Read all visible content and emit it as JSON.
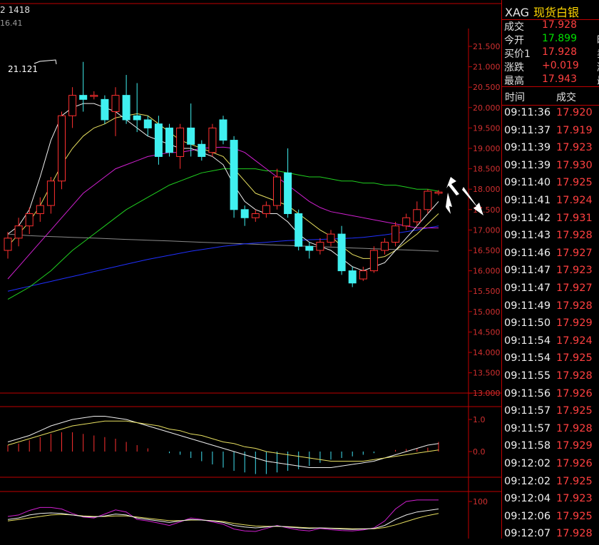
{
  "header": {
    "top_left": "2 1418",
    "sub_left": "16.41"
  },
  "main_chart": {
    "high_label": "21.121",
    "y_ticks": [
      "21.500",
      "21.000",
      "20.500",
      "20.000",
      "19.500",
      "19.000",
      "18.500",
      "18.000",
      "17.500",
      "17.000",
      "16.500",
      "16.000",
      "15.500",
      "15.000",
      "14.500",
      "14.000",
      "13.500",
      "13.000"
    ],
    "candles": [
      [
        16.5,
        16.8,
        16.3,
        16.95
      ],
      [
        16.8,
        17.1,
        16.6,
        17.3
      ],
      [
        17.1,
        17.4,
        16.9,
        17.55
      ],
      [
        17.4,
        17.6,
        17.2,
        17.8
      ],
      [
        17.6,
        18.2,
        17.4,
        18.3
      ],
      [
        18.2,
        19.8,
        18.0,
        19.9
      ],
      [
        19.8,
        20.3,
        19.5,
        20.5
      ],
      [
        20.3,
        20.2,
        19.9,
        21.12
      ],
      [
        20.3,
        20.3,
        20.2,
        20.4
      ],
      [
        20.2,
        19.7,
        19.6,
        20.3
      ],
      [
        19.9,
        20.3,
        19.3,
        20.5
      ],
      [
        20.3,
        19.7,
        19.6,
        20.8
      ],
      [
        19.8,
        19.7,
        19.4,
        20.6
      ],
      [
        19.7,
        19.5,
        19.3,
        19.8
      ],
      [
        19.6,
        18.8,
        18.6,
        19.8
      ],
      [
        19.5,
        18.9,
        18.8,
        19.6
      ],
      [
        18.8,
        19.5,
        18.5,
        19.6
      ],
      [
        19.5,
        19.1,
        18.8,
        20.1
      ],
      [
        19.1,
        18.8,
        18.7,
        19.2
      ],
      [
        18.9,
        19.5,
        18.8,
        19.6
      ],
      [
        19.7,
        19.2,
        19.1,
        19.8
      ],
      [
        19.2,
        17.5,
        17.3,
        19.3
      ],
      [
        17.5,
        17.3,
        17.1,
        17.6
      ],
      [
        17.3,
        17.4,
        17.2,
        17.5
      ],
      [
        17.4,
        17.6,
        17.3,
        17.7
      ],
      [
        17.6,
        18.3,
        17.5,
        18.5
      ],
      [
        18.4,
        17.4,
        17.3,
        19.0
      ],
      [
        17.4,
        16.6,
        16.5,
        17.5
      ],
      [
        16.6,
        16.5,
        16.3,
        16.7
      ],
      [
        16.5,
        16.7,
        16.4,
        16.8
      ],
      [
        16.7,
        16.9,
        16.6,
        17.0
      ],
      [
        16.9,
        16.0,
        15.9,
        17.1
      ],
      [
        16.0,
        15.7,
        15.6,
        16.1
      ],
      [
        15.8,
        16.0,
        15.75,
        16.1
      ],
      [
        16.0,
        16.5,
        15.95,
        16.6
      ],
      [
        16.5,
        16.7,
        16.4,
        16.8
      ],
      [
        16.7,
        17.1,
        16.6,
        17.2
      ],
      [
        17.1,
        17.3,
        17.0,
        17.4
      ],
      [
        17.2,
        17.5,
        17.1,
        17.7
      ],
      [
        17.5,
        17.95,
        17.4,
        18.0
      ],
      [
        17.9,
        17.93,
        17.85,
        17.98
      ]
    ],
    "ma_yellow": [
      16.6,
      16.9,
      17.2,
      17.6,
      18.1,
      18.6,
      19.0,
      19.3,
      19.5,
      19.6,
      19.75,
      19.8,
      19.85,
      19.8,
      19.6,
      19.4,
      19.2,
      19.1,
      19.0,
      18.9,
      18.8,
      18.5,
      18.2,
      17.9,
      17.8,
      17.7,
      17.6,
      17.4,
      17.2,
      17.0,
      16.85,
      16.6,
      16.4,
      16.3,
      16.3,
      16.35,
      16.5,
      16.7,
      16.9,
      17.15,
      17.4
    ],
    "ma_white": [
      16.9,
      17.1,
      17.5,
      18.3,
      19.2,
      19.8,
      20.0,
      20.1,
      20.1,
      20.0,
      19.9,
      19.7,
      19.5,
      19.3,
      19.2,
      19.1,
      19.0,
      19.0,
      18.9,
      18.8,
      18.6,
      18.1,
      17.7,
      17.5,
      17.4,
      17.4,
      17.2,
      16.9,
      16.7,
      16.6,
      16.5,
      16.3,
      16.1,
      16.0,
      16.1,
      16.2,
      16.5,
      16.8,
      17.1,
      17.4,
      17.7
    ],
    "ma_magenta": [
      15.8,
      16.1,
      16.4,
      16.7,
      17.0,
      17.3,
      17.6,
      17.9,
      18.1,
      18.3,
      18.5,
      18.6,
      18.7,
      18.8,
      18.85,
      18.9,
      18.9,
      18.95,
      19.0,
      19.02,
      19.03,
      19.0,
      18.9,
      18.7,
      18.5,
      18.3,
      18.1,
      17.9,
      17.7,
      17.55,
      17.45,
      17.4,
      17.35,
      17.3,
      17.25,
      17.2,
      17.15,
      17.1,
      17.05,
      17.05,
      17.05
    ],
    "ma_green": [
      15.3,
      15.45,
      15.6,
      15.8,
      16.0,
      16.25,
      16.5,
      16.7,
      16.9,
      17.1,
      17.3,
      17.5,
      17.65,
      17.8,
      17.95,
      18.1,
      18.2,
      18.3,
      18.4,
      18.45,
      18.5,
      18.5,
      18.5,
      18.5,
      18.45,
      18.45,
      18.4,
      18.35,
      18.3,
      18.3,
      18.25,
      18.2,
      18.2,
      18.15,
      18.15,
      18.1,
      18.1,
      18.05,
      18.0,
      18.0,
      17.95
    ],
    "ma_blue": [
      15.5,
      15.56,
      15.62,
      15.68,
      15.74,
      15.8,
      15.86,
      15.92,
      15.98,
      16.04,
      16.1,
      16.16,
      16.22,
      16.28,
      16.33,
      16.38,
      16.43,
      16.48,
      16.52,
      16.56,
      16.6,
      16.63,
      16.66,
      16.68,
      16.7,
      16.72,
      16.74,
      16.75,
      16.76,
      16.77,
      16.78,
      16.79,
      16.8,
      16.82,
      16.85,
      16.88,
      16.92,
      16.96,
      17.0,
      17.05,
      17.1
    ],
    "ma_gray": [
      16.9,
      16.88,
      16.86,
      16.85,
      16.84,
      16.83,
      16.82,
      16.81,
      16.8,
      16.79,
      16.78,
      16.77,
      16.76,
      16.75,
      16.74,
      16.73,
      16.72,
      16.71,
      16.7,
      16.69,
      16.68,
      16.67,
      16.66,
      16.65,
      16.64,
      16.63,
      16.62,
      16.61,
      16.6,
      16.59,
      16.58,
      16.57,
      16.56,
      16.55,
      16.54,
      16.53,
      16.52,
      16.51,
      16.5,
      16.49,
      16.48
    ]
  },
  "macd_panel": {
    "y_ticks": [
      "1.0",
      "0.0"
    ],
    "bars": [
      0.2,
      0.25,
      0.35,
      0.45,
      0.55,
      0.6,
      0.6,
      0.55,
      0.5,
      0.45,
      0.4,
      0.3,
      0.2,
      0.1,
      0.0,
      -0.05,
      -0.1,
      -0.2,
      -0.3,
      -0.4,
      -0.5,
      -0.6,
      -0.65,
      -0.7,
      -0.7,
      -0.65,
      -0.6,
      -0.55,
      -0.45,
      -0.35,
      -0.25,
      -0.2,
      -0.15,
      -0.1,
      -0.05,
      0.0,
      0.05,
      0.08,
      0.1,
      0.12,
      0.3
    ],
    "dif": [
      0.3,
      0.4,
      0.5,
      0.65,
      0.8,
      0.9,
      1.0,
      1.05,
      1.1,
      1.1,
      1.05,
      1.0,
      0.9,
      0.8,
      0.7,
      0.6,
      0.5,
      0.4,
      0.3,
      0.2,
      0.1,
      0.0,
      -0.1,
      -0.2,
      -0.3,
      -0.35,
      -0.4,
      -0.45,
      -0.5,
      -0.5,
      -0.5,
      -0.45,
      -0.4,
      -0.35,
      -0.3,
      -0.2,
      -0.1,
      0.0,
      0.1,
      0.2,
      0.25
    ],
    "dea": [
      0.2,
      0.3,
      0.4,
      0.5,
      0.6,
      0.7,
      0.8,
      0.85,
      0.9,
      0.95,
      0.95,
      0.95,
      0.9,
      0.85,
      0.8,
      0.7,
      0.65,
      0.55,
      0.5,
      0.4,
      0.3,
      0.25,
      0.15,
      0.1,
      0.0,
      -0.05,
      -0.1,
      -0.15,
      -0.2,
      -0.25,
      -0.3,
      -0.3,
      -0.3,
      -0.3,
      -0.25,
      -0.2,
      -0.15,
      -0.1,
      -0.05,
      0.0,
      0.05
    ]
  },
  "kdj_panel": {
    "y_ticks": [
      "100"
    ],
    "k": [
      40,
      45,
      55,
      60,
      62,
      60,
      55,
      50,
      48,
      52,
      58,
      55,
      45,
      40,
      35,
      30,
      35,
      40,
      38,
      35,
      30,
      20,
      15,
      12,
      15,
      18,
      15,
      12,
      10,
      12,
      10,
      8,
      7,
      8,
      10,
      20,
      40,
      55,
      65,
      70,
      75
    ],
    "d": [
      35,
      40,
      45,
      50,
      55,
      57,
      55,
      52,
      50,
      50,
      52,
      52,
      48,
      44,
      40,
      36,
      36,
      38,
      38,
      36,
      33,
      27,
      22,
      18,
      17,
      17,
      16,
      14,
      12,
      12,
      11,
      10,
      9,
      9,
      9,
      13,
      22,
      33,
      44,
      53,
      60
    ],
    "j": [
      50,
      55,
      70,
      80,
      80,
      75,
      60,
      48,
      45,
      58,
      72,
      65,
      40,
      35,
      28,
      20,
      32,
      45,
      40,
      32,
      24,
      8,
      2,
      0,
      10,
      20,
      12,
      5,
      2,
      10,
      6,
      3,
      2,
      5,
      12,
      35,
      75,
      100,
      105,
      105,
      105
    ]
  },
  "quote": {
    "code": "XAG",
    "name": "现货白银",
    "rows": [
      {
        "label": "成交",
        "value": "17.928",
        "color": "#ff4040",
        "cut": ""
      },
      {
        "label": "今开",
        "value": "17.899",
        "color": "#00e000",
        "cut": "昨"
      },
      {
        "label": "买价1",
        "value": "17.928",
        "color": "#ff4040",
        "cut": "卖"
      },
      {
        "label": "涨跌",
        "value": "+0.019",
        "color": "#ff4040",
        "cut": "涨"
      },
      {
        "label": "最高",
        "value": "17.943",
        "color": "#ff4040",
        "cut": "最"
      }
    ]
  },
  "trades": {
    "header_time": "时间",
    "header_price": "成交",
    "rows": [
      [
        "09:11:36",
        "17.920"
      ],
      [
        "09:11:37",
        "17.919"
      ],
      [
        "09:11:39",
        "17.923"
      ],
      [
        "09:11:39",
        "17.930"
      ],
      [
        "09:11:40",
        "17.925"
      ],
      [
        "09:11:41",
        "17.924"
      ],
      [
        "09:11:42",
        "17.931"
      ],
      [
        "09:11:43",
        "17.928"
      ],
      [
        "09:11:46",
        "17.927"
      ],
      [
        "09:11:47",
        "17.923"
      ],
      [
        "09:11:47",
        "17.927"
      ],
      [
        "09:11:49",
        "17.928"
      ],
      [
        "09:11:50",
        "17.929"
      ],
      [
        "09:11:54",
        "17.924"
      ],
      [
        "09:11:54",
        "17.925"
      ],
      [
        "09:11:55",
        "17.928"
      ],
      [
        "09:11:56",
        "17.926"
      ],
      [
        "09:11:57",
        "17.925"
      ],
      [
        "09:11:57",
        "17.928"
      ],
      [
        "09:11:58",
        "17.929"
      ],
      [
        "09:12:02",
        "17.926"
      ],
      [
        "09:12:02",
        "17.925"
      ],
      [
        "09:12:04",
        "17.923"
      ],
      [
        "09:12:06",
        "17.925"
      ],
      [
        "09:12:07",
        "17.928"
      ]
    ]
  }
}
